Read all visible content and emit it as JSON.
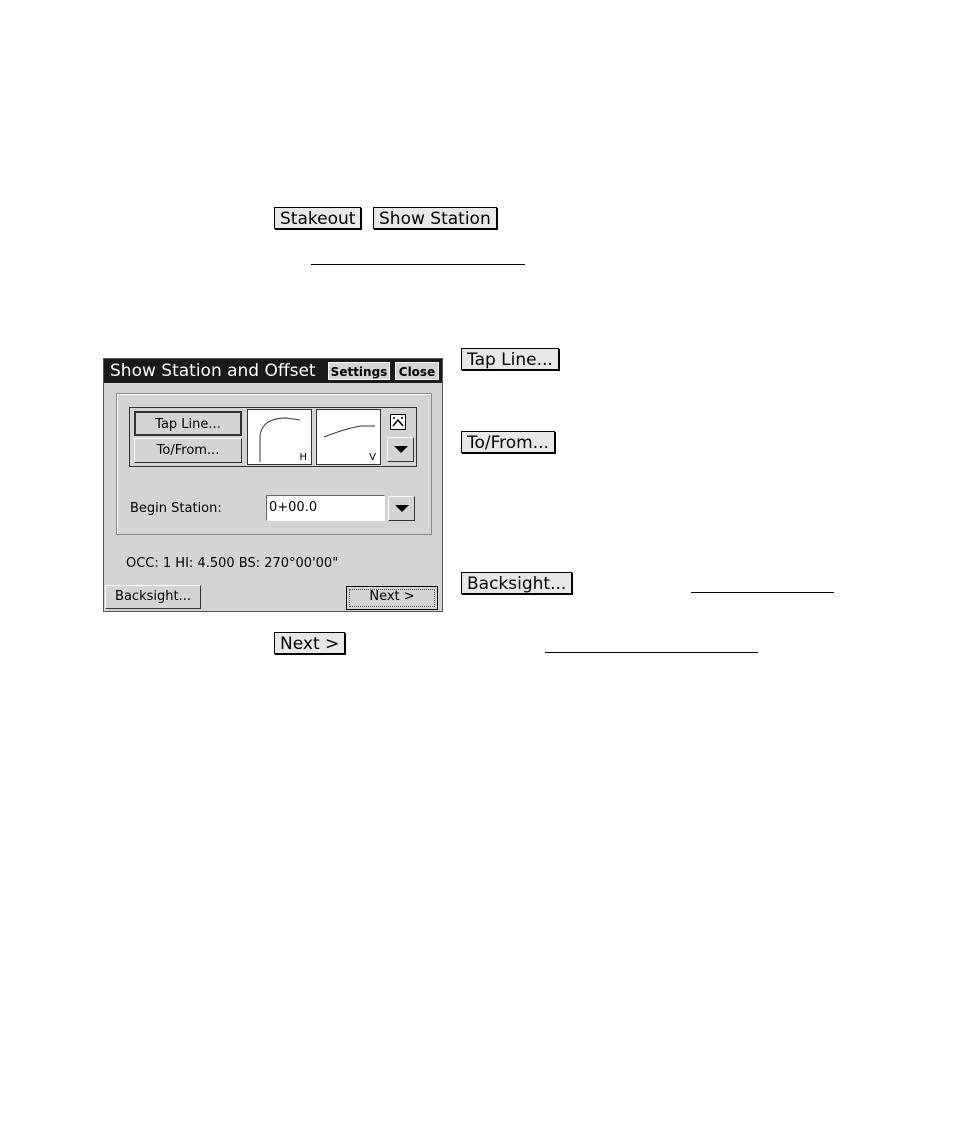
{
  "intro": {
    "stakeout_button": "Stakeout",
    "show_station_button": "Show Station"
  },
  "dialog": {
    "title": "Show Station and Offset",
    "settings_button": "Settings",
    "close_button": "Close",
    "tap_line_button": "Tap Line...",
    "to_from_button": "To/From...",
    "preview_h_label": "H",
    "preview_v_label": "V",
    "begin_station_label": "Begin Station:",
    "begin_station_value": "0+00.0",
    "status_text": "OCC: 1  HI: 4.500  BS: 270°00'00\"",
    "backsight_button": "Backsight...",
    "next_button": "Next >"
  },
  "callouts": {
    "tap_line_button": "Tap Line...",
    "to_from_button": "To/From...",
    "backsight_button": "Backsight...",
    "next_button": "Next >"
  }
}
